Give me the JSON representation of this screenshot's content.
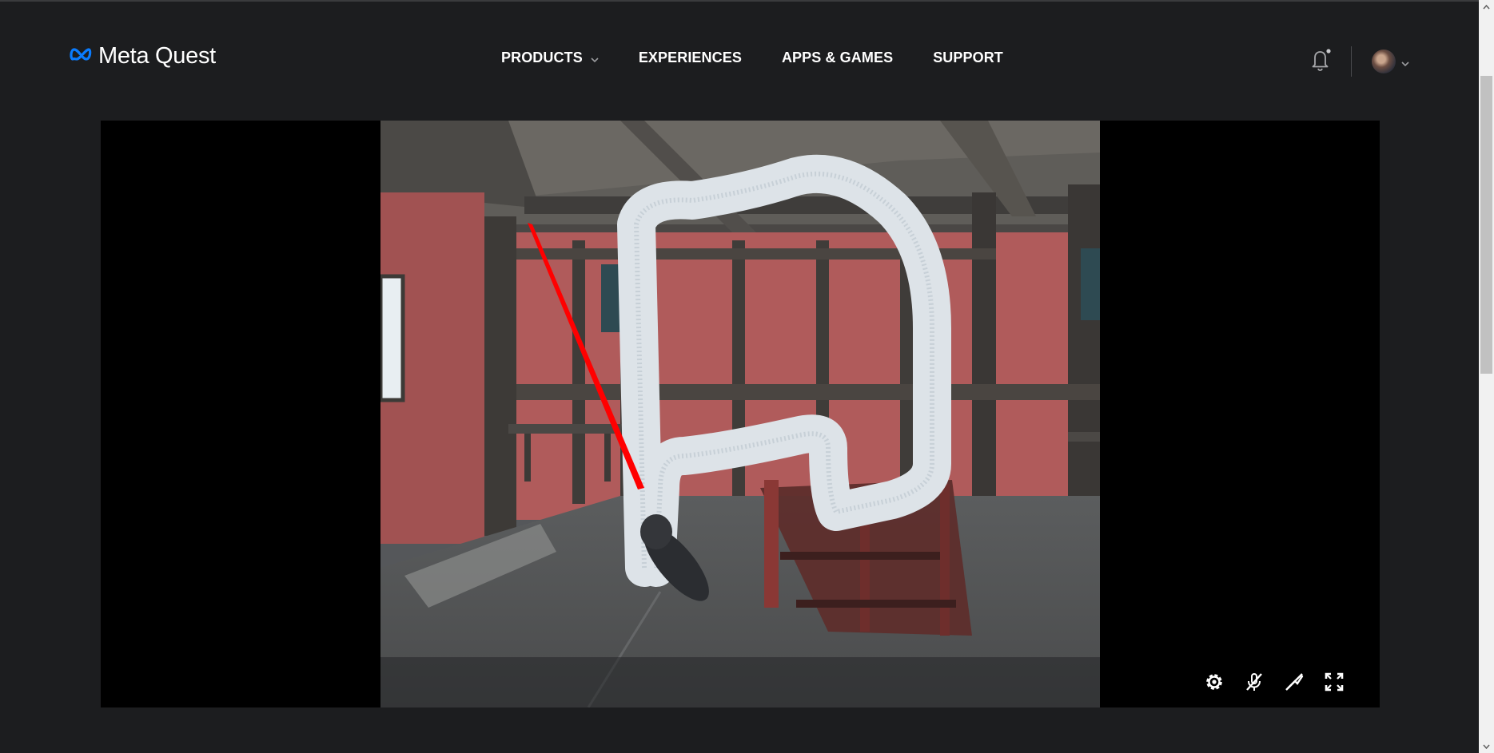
{
  "brand": {
    "name": "Meta Quest",
    "logo_icon": "meta-infinity-icon",
    "logo_color": "#0a7cff"
  },
  "nav": {
    "items": [
      {
        "label": "PRODUCTS",
        "has_dropdown": true
      },
      {
        "label": "EXPERIENCES"
      },
      {
        "label": "APPS & GAMES"
      },
      {
        "label": "SUPPORT"
      }
    ]
  },
  "header_actions": {
    "notifications_icon": "bell-icon",
    "avatar_icon": "user-avatar",
    "avatar_menu_icon": "chevron-down-icon"
  },
  "player": {
    "controls": [
      {
        "name": "settings",
        "icon": "gear-icon"
      },
      {
        "name": "mute-microphone",
        "icon": "mic-off-icon"
      },
      {
        "name": "cast-off",
        "icon": "cast-off-icon"
      },
      {
        "name": "fullscreen",
        "icon": "fullscreen-icon"
      }
    ]
  },
  "colors": {
    "page_bg": "#1c1d1f",
    "pointer_ray": "#ff0000",
    "brush_stroke": "#d9e1e8"
  }
}
